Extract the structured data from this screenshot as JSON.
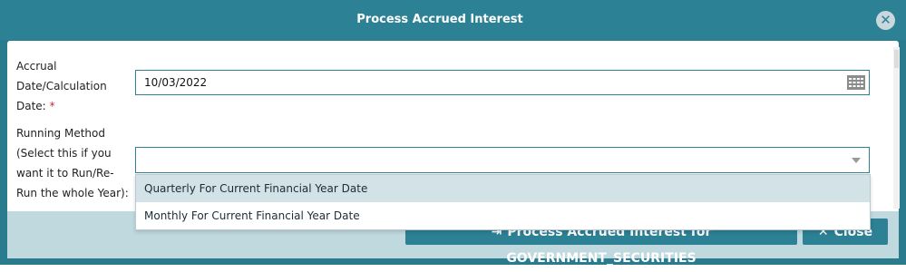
{
  "dialog": {
    "title": "Process Accrued Interest",
    "close_icon": "close-icon"
  },
  "form": {
    "accrual_date": {
      "label_line1": "Accrual",
      "label_line2": "Date/Calculation",
      "label_line3": "Date:",
      "required_mark": "*",
      "value": "10/03/2022",
      "icon": "calendar-icon"
    },
    "running_method": {
      "label_line1": "Running Method",
      "label_line2": "(Select this if you",
      "label_line3": "want it to Run/Re-",
      "label_line4": "Run the whole Year):",
      "value": "",
      "icon": "chevron-down-icon",
      "options": [
        "Quarterly For Current Financial Year Date",
        "Monthly For Current Financial Year Date"
      ],
      "highlighted_option": "Quarterly For Current Financial Year Date"
    }
  },
  "footer": {
    "process_button": "Process Accrued Interest for GOVERNMENT_SECURITIES",
    "close_button": "Close"
  },
  "colors": {
    "header": "#2c8195",
    "footer": "#bfd9df",
    "highlight": "#d3e2e6"
  }
}
